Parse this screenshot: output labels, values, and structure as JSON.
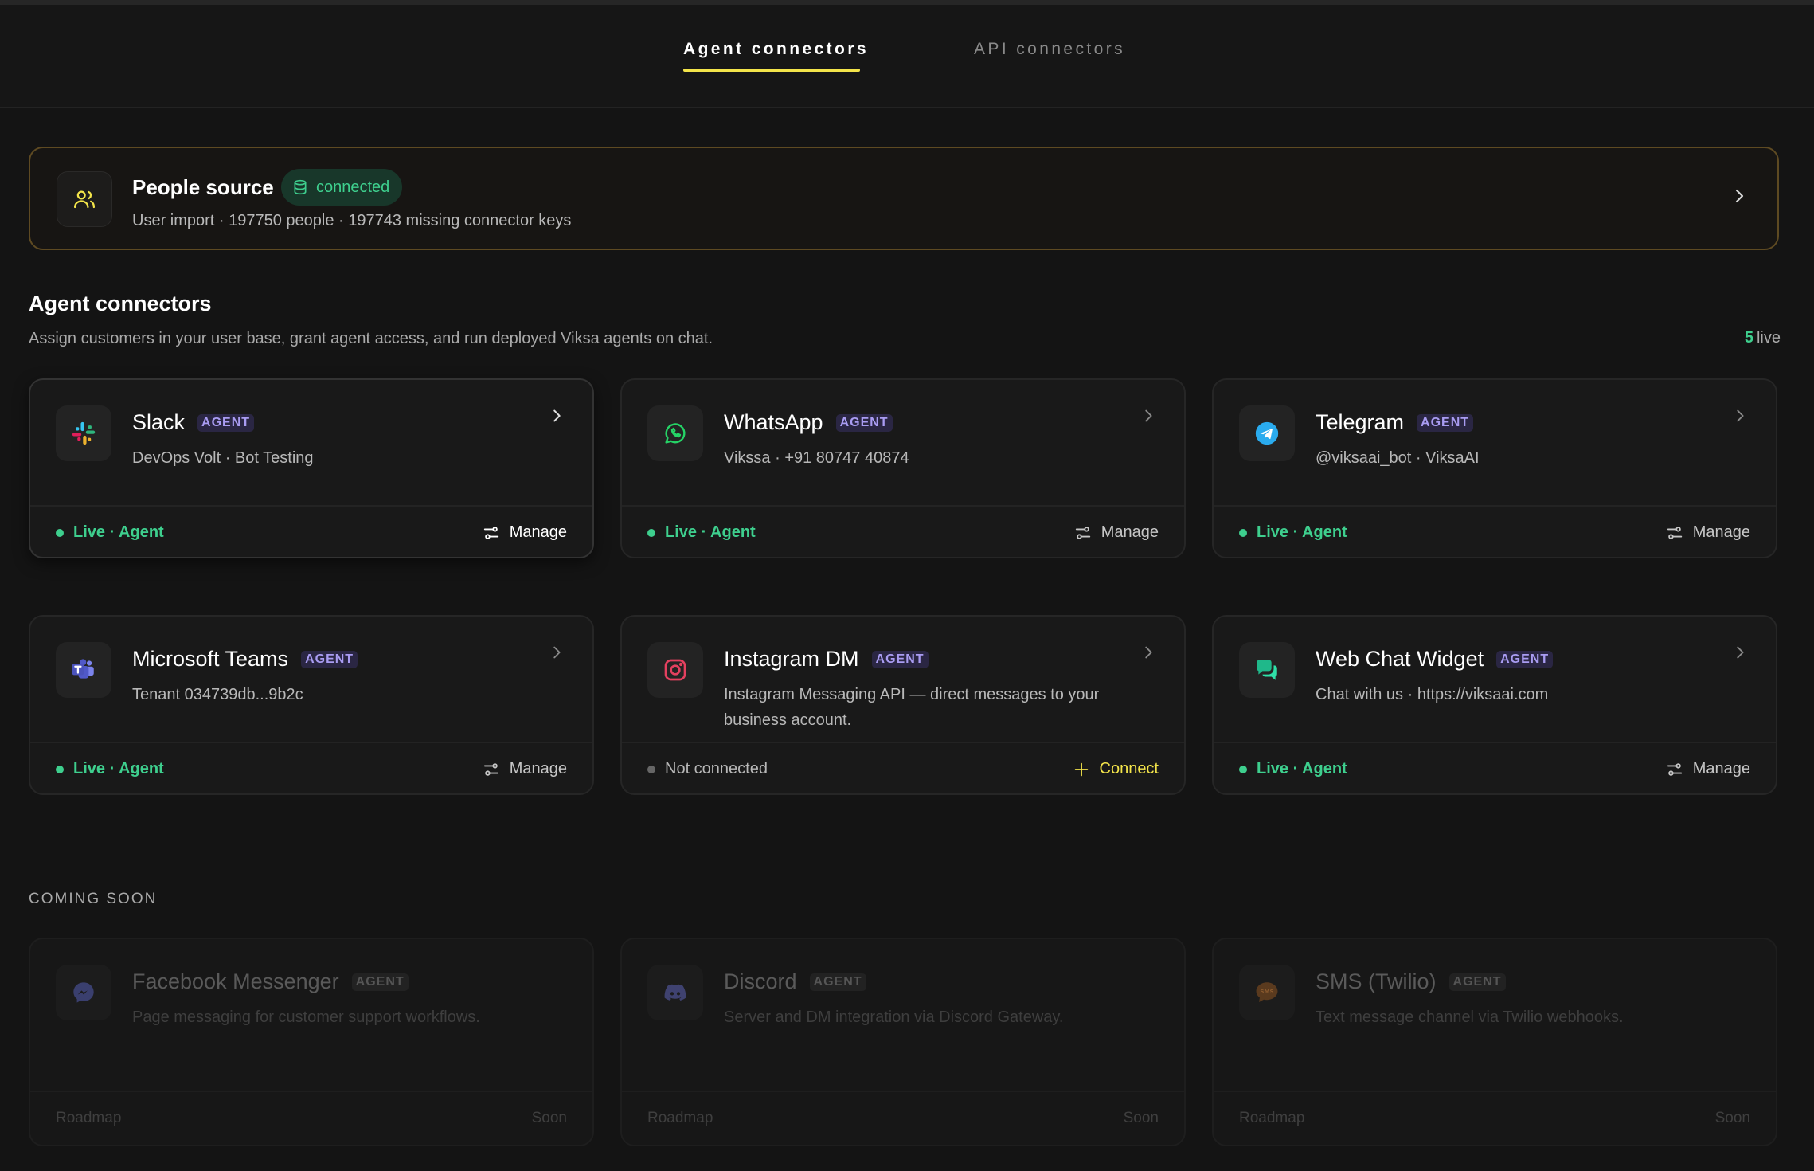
{
  "tabs": [
    {
      "label": "Agent connectors",
      "active": true
    },
    {
      "label": "API connectors",
      "active": false
    }
  ],
  "people_source": {
    "title": "People source",
    "status": "connected",
    "subtitle": "User import · 197750 people · 197743 missing connector keys"
  },
  "section": {
    "title": "Agent connectors",
    "description": "Assign customers in your user base, grant agent access, and run deployed Viksa agents on chat.",
    "live_count": "5",
    "live_label": "live"
  },
  "connectors": [
    {
      "name": "Slack",
      "badge": "AGENT",
      "desc": "DevOps Volt · Bot Testing",
      "status": "Live · Agent",
      "action": "Manage",
      "icon": "slack-icon"
    },
    {
      "name": "WhatsApp",
      "badge": "AGENT",
      "desc": "Vikssa · +91 80747 40874",
      "status": "Live · Agent",
      "action": "Manage",
      "icon": "whatsapp-icon"
    },
    {
      "name": "Telegram",
      "badge": "AGENT",
      "desc": "@viksaai_bot · ViksaAI",
      "status": "Live · Agent",
      "action": "Manage",
      "icon": "telegram-icon"
    },
    {
      "name": "Microsoft Teams",
      "badge": "AGENT",
      "desc": "Tenant 034739db...9b2c",
      "status": "Live · Agent",
      "action": "Manage",
      "icon": "teams-icon"
    },
    {
      "name": "Instagram DM",
      "badge": "AGENT",
      "desc": "Instagram Messaging API — direct messages to your business account.",
      "status": "Not connected",
      "action": "Connect",
      "icon": "instagram-icon"
    },
    {
      "name": "Web Chat Widget",
      "badge": "AGENT",
      "desc": "Chat with us · https://viksaai.com",
      "status": "Live · Agent",
      "action": "Manage",
      "icon": "chat-bubbles-icon"
    }
  ],
  "coming_soon": {
    "label": "COMING SOON",
    "items": [
      {
        "name": "Facebook Messenger",
        "badge": "AGENT",
        "desc": "Page messaging for customer support workflows.",
        "left": "Roadmap",
        "right": "Soon",
        "icon": "messenger-icon"
      },
      {
        "name": "Discord",
        "badge": "AGENT",
        "desc": "Server and DM integration via Discord Gateway.",
        "left": "Roadmap",
        "right": "Soon",
        "icon": "discord-icon"
      },
      {
        "name": "SMS (Twilio)",
        "badge": "AGENT",
        "desc": "Text message channel via Twilio webhooks.",
        "left": "Roadmap",
        "right": "Soon",
        "icon": "sms-icon"
      }
    ]
  },
  "colors": {
    "accent_yellow": "#f3e44a",
    "live_green": "#3ecf8e",
    "badge_purple": "#a99cf2"
  }
}
